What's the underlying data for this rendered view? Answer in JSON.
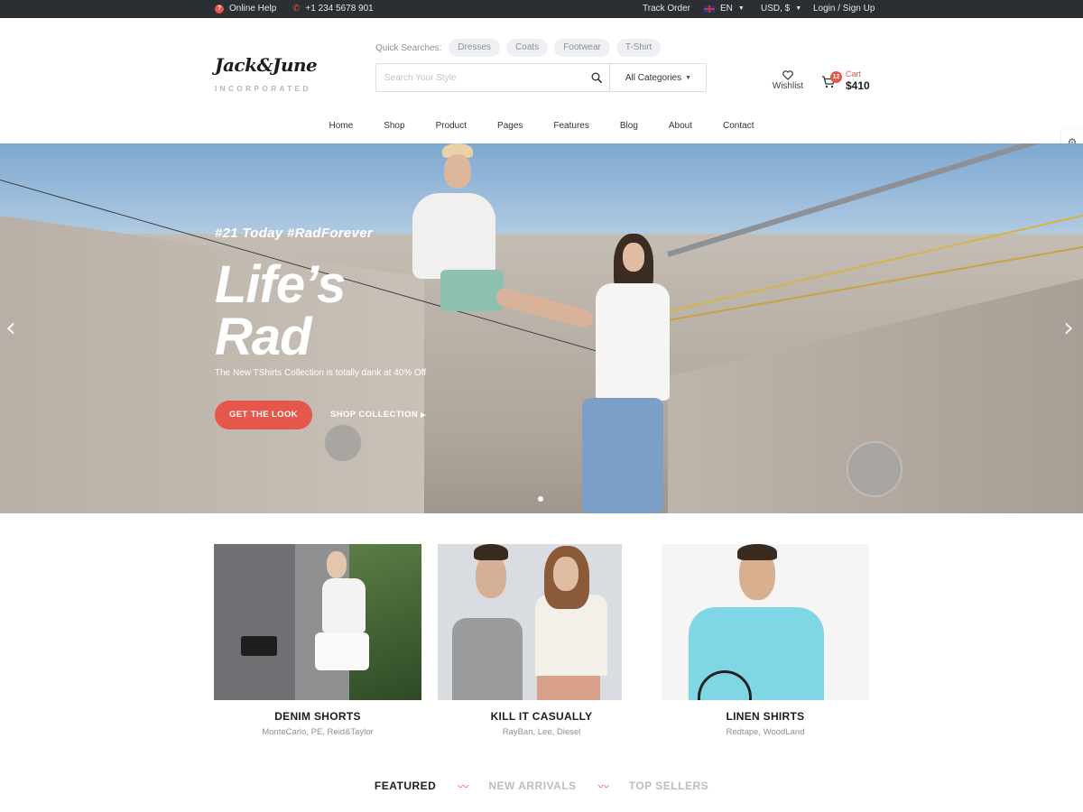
{
  "topbar": {
    "help_label": "Online Help",
    "help_icon": "question-icon",
    "phone": "+1 234 5678 901",
    "phone_icon": "phone-icon",
    "track_order": "Track Order",
    "language": "EN",
    "currency": "USD, $",
    "login": "Login / Sign Up"
  },
  "logo": {
    "name": "Jack&June",
    "tagline": "INCORPORATED"
  },
  "quick_search": {
    "label": "Quick Searches:",
    "chips": [
      "Dresses",
      "Coats",
      "Footwear",
      "T-Shirt"
    ]
  },
  "search": {
    "placeholder": "Search Your Style",
    "category": "All Categories"
  },
  "wishlist": {
    "label": "Wishlist"
  },
  "cart": {
    "label": "Cart",
    "count": "12",
    "total": "$410"
  },
  "nav": [
    "Home",
    "Shop",
    "Product",
    "Pages",
    "Features",
    "Blog",
    "About",
    "Contact"
  ],
  "hero": {
    "tagline": "#21 Today #RadForever",
    "title_line1": "Life’s",
    "title_line2": "Rad",
    "subtitle": "The New TShirts Collection is totally dank at 40% Off",
    "primary_button": "GET THE LOOK",
    "secondary_button": "SHOP COLLECTION"
  },
  "categories": [
    {
      "title": "DENIM SHORTS",
      "brands": "MonteCarlo, PE, Reid&Taylor"
    },
    {
      "title": "KILL IT CASUALLY",
      "brands": "RayBan, Lee, Diesel"
    },
    {
      "title": "LINEN SHIRTS",
      "brands": "Redtape, WoodLand"
    }
  ],
  "tabs": [
    "FEATURED",
    "NEW ARRIVALS",
    "TOP SELLERS"
  ],
  "colors": {
    "accent": "#e4574a",
    "topbar_bg": "#2b2e33",
    "muted_text": "#8a9096"
  }
}
